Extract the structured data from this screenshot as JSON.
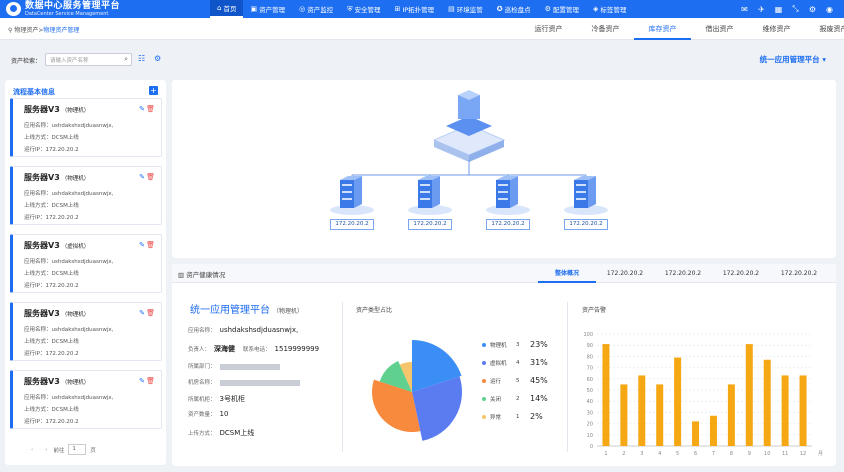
{
  "app": {
    "title_cn": "数据中心服务管理平台",
    "title_en": "DataCenter Service Management"
  },
  "nav": [
    {
      "label": "首页",
      "icon": "⌂",
      "active": true
    },
    {
      "label": "资产管理",
      "icon": "▣"
    },
    {
      "label": "资产监控",
      "icon": "◎"
    },
    {
      "label": "安全管理",
      "icon": "⛨"
    },
    {
      "label": "IP拓扑管理",
      "icon": "⊞"
    },
    {
      "label": "环境监管",
      "icon": "▤"
    },
    {
      "label": "巡检盘点",
      "icon": "✪"
    },
    {
      "label": "配置管理",
      "icon": "⚙"
    },
    {
      "label": "标签管理",
      "icon": "◈"
    }
  ],
  "breadcrumb": {
    "root": "物理资产",
    "sep": ">",
    "current": "物理资产管理"
  },
  "tabs": [
    "运行资产",
    "冷备资产",
    "库存资产",
    "借出资产",
    "维修资产",
    "报废资产"
  ],
  "search": {
    "label": "资产检索：",
    "placeholder": "请输入资产名称"
  },
  "platform_select": "统一应用管理平台",
  "left": {
    "title": "流程基本信息",
    "cards": [
      {
        "name": "服务器V3",
        "type": "（物理机）",
        "app": "应用名称：ushdakshsdjduasnwjx,",
        "method": "上线方式：DCSM上线",
        "ip": "运行IP：172.20.20.2"
      },
      {
        "name": "服务器V3",
        "type": "（物理机）",
        "app": "应用名称：ushdakshsdjduasnwjx,",
        "method": "上线方式：DCSM上线",
        "ip": "运行IP：172.20.20.2"
      },
      {
        "name": "服务器V3",
        "type": "（虚拟机）",
        "app": "应用名称：ushdakshsdjduasnwjx,",
        "method": "上线方式：DCSM上线",
        "ip": "运行IP：172.20.20.2"
      },
      {
        "name": "服务器V3",
        "type": "（物理机）",
        "app": "应用名称：ushdakshsdjduasnwjx,",
        "method": "上线方式：DCSM上线",
        "ip": "运行IP：172.20.20.2"
      },
      {
        "name": "服务器V3",
        "type": "（物理机）",
        "app": "应用名称：ushdakshsdjduasnwjx,",
        "method": "上线方式：DCSM上线",
        "ip": "运行IP：172.20.20.2"
      }
    ],
    "pager": {
      "prev": "‹",
      "next": "›",
      "goto": "前往",
      "page": "1",
      "page_suffix": "页"
    }
  },
  "topology": {
    "servers": [
      "172.20.20.2",
      "172.20.20.2",
      "172.20.20.2",
      "172.20.20.2"
    ]
  },
  "health": {
    "title": "资产健康情况",
    "tabs": [
      "整体概况",
      "172.20.20.2",
      "172.20.20.2",
      "172.20.20.2",
      "172.20.20.2"
    ],
    "info": {
      "name": "统一应用管理平台",
      "type": "（物理机）",
      "app_label": "应用名称：",
      "app_value": "ushdakshsdjduasnwjx,",
      "owner_label": "负责人：",
      "owner_value": "深海健",
      "phone_label": "联系电话：",
      "phone_value": "1519999999",
      "dept_label": "所属部门：",
      "room_label": "机房名称：",
      "cabinet_label": "所属机柜：",
      "cabinet_value": "3号机柜",
      "count_label": "资产数量：",
      "count_value": "10",
      "method_label": "上传方式：",
      "method_value": "DCSM上线"
    },
    "type_title": "资产类型占比",
    "alarm_title": "资产告警"
  },
  "chart_data": [
    {
      "type": "pie",
      "title": "资产类型占比",
      "slices": [
        {
          "name": "物理机",
          "count": 3,
          "percent": "23%",
          "color": "#3a8ef6"
        },
        {
          "name": "虚拟机",
          "count": 4,
          "percent": "31%",
          "color": "#5b7cf0"
        },
        {
          "name": "运行",
          "count": 5,
          "percent": "45%",
          "color": "#f78a3d"
        },
        {
          "name": "关闭",
          "count": 2,
          "percent": "14%",
          "color": "#5fd08e"
        },
        {
          "name": "异常",
          "count": 1,
          "percent": "2%",
          "color": "#f5c56b"
        }
      ]
    },
    {
      "type": "bar",
      "title": "资产告警",
      "color": "#f5a814",
      "categories": [
        "1",
        "2",
        "3",
        "4",
        "5",
        "6",
        "7",
        "8",
        "9",
        "10",
        "11",
        "12"
      ],
      "unit": "月",
      "values": [
        91,
        55,
        63,
        55,
        79,
        22,
        27,
        55,
        91,
        77,
        63,
        63
      ],
      "ylim": [
        0,
        100
      ],
      "yticks": [
        "0",
        "10",
        "20",
        "30",
        "40",
        "50",
        "60",
        "70",
        "80",
        "90",
        "100"
      ]
    }
  ]
}
